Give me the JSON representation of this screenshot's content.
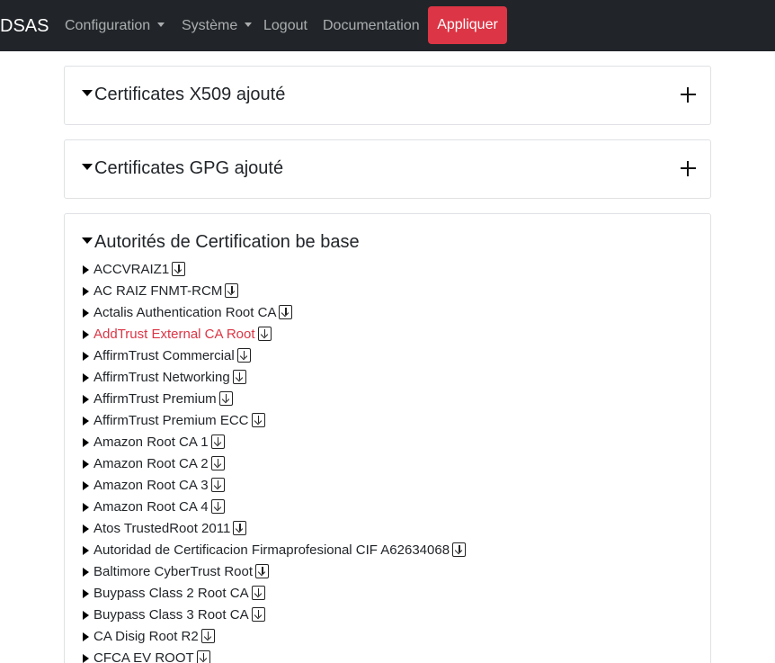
{
  "navbar": {
    "brand": "DSAS",
    "items": [
      {
        "label": "Configuration",
        "dropdown": true
      },
      {
        "label": "Système",
        "dropdown": true
      },
      {
        "label": "Logout",
        "dropdown": false
      },
      {
        "label": "Documentation",
        "dropdown": false
      }
    ],
    "apply_label": "Appliquer"
  },
  "sections": {
    "x509": {
      "title": "Certificates X509 ajouté"
    },
    "gpg": {
      "title": "Certificates GPG ajouté"
    },
    "base": {
      "title": "Autorités de Certification be base",
      "items": [
        {
          "name": "ACCVRAIZ1",
          "warn": false
        },
        {
          "name": "AC RAIZ FNMT-RCM",
          "warn": false
        },
        {
          "name": "Actalis Authentication Root CA",
          "warn": false
        },
        {
          "name": "AddTrust External CA Root",
          "warn": true
        },
        {
          "name": "AffirmTrust Commercial",
          "warn": false
        },
        {
          "name": "AffirmTrust Networking",
          "warn": false
        },
        {
          "name": "AffirmTrust Premium",
          "warn": false
        },
        {
          "name": "AffirmTrust Premium ECC",
          "warn": false
        },
        {
          "name": "Amazon Root CA 1",
          "warn": false
        },
        {
          "name": "Amazon Root CA 2",
          "warn": false
        },
        {
          "name": "Amazon Root CA 3",
          "warn": false
        },
        {
          "name": "Amazon Root CA 4",
          "warn": false
        },
        {
          "name": "Atos TrustedRoot 2011",
          "warn": false
        },
        {
          "name": "Autoridad de Certificacion Firmaprofesional CIF A62634068",
          "warn": false
        },
        {
          "name": "Baltimore CyberTrust Root",
          "warn": false
        },
        {
          "name": "Buypass Class 2 Root CA",
          "warn": false
        },
        {
          "name": "Buypass Class 3 Root CA",
          "warn": false
        },
        {
          "name": "CA Disig Root R2",
          "warn": false
        },
        {
          "name": "CFCA EV ROOT",
          "warn": false
        }
      ]
    }
  },
  "colors": {
    "navbar_bg": "#212529",
    "apply_button": "#dc3545",
    "warning_text": "#dc3545"
  }
}
